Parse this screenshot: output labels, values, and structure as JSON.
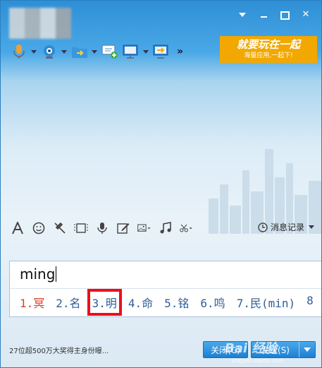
{
  "window": {
    "avatar_alt": "blurred contact avatar",
    "buttons": [
      "menu",
      "minimize",
      "maximize",
      "close"
    ]
  },
  "toolbar": {
    "icons": [
      "microphone-icon",
      "webcam-icon",
      "file-transfer-icon",
      "add-chat-icon",
      "screen-share-icon",
      "remote-assist-icon"
    ],
    "more_label": "»"
  },
  "banner": {
    "line1": "就要玩在一起",
    "line2": "海量应用,一起下!",
    "color": "#f2a800"
  },
  "input_toolbar": {
    "icons": [
      "font-icon",
      "emoji-icon",
      "nudge-icon",
      "gif-icon",
      "voice-message-icon",
      "doodle-icon",
      "picture-icon",
      "music-icon",
      "scissors-icon"
    ],
    "history_label": "消息记录"
  },
  "ime": {
    "composition": "ming",
    "candidates": [
      "1.冥",
      "2.名",
      "3.明",
      "4.命",
      "5.铭",
      "6.鸣",
      "7.民(min)",
      "8"
    ],
    "highlighted_index": 2
  },
  "footer": {
    "ad_text": "27位超500万大奖得主身份曝...",
    "close_label": "关闭(C)",
    "send_label": "发送(S)",
    "watermark": "Bai 经验",
    "watermark_url": "jingyan.baidu.com"
  },
  "colors": {
    "title_blue": "#2f8fd6",
    "button_blue": "#1d7fd1",
    "highlight_red": "#ee0f1a"
  }
}
